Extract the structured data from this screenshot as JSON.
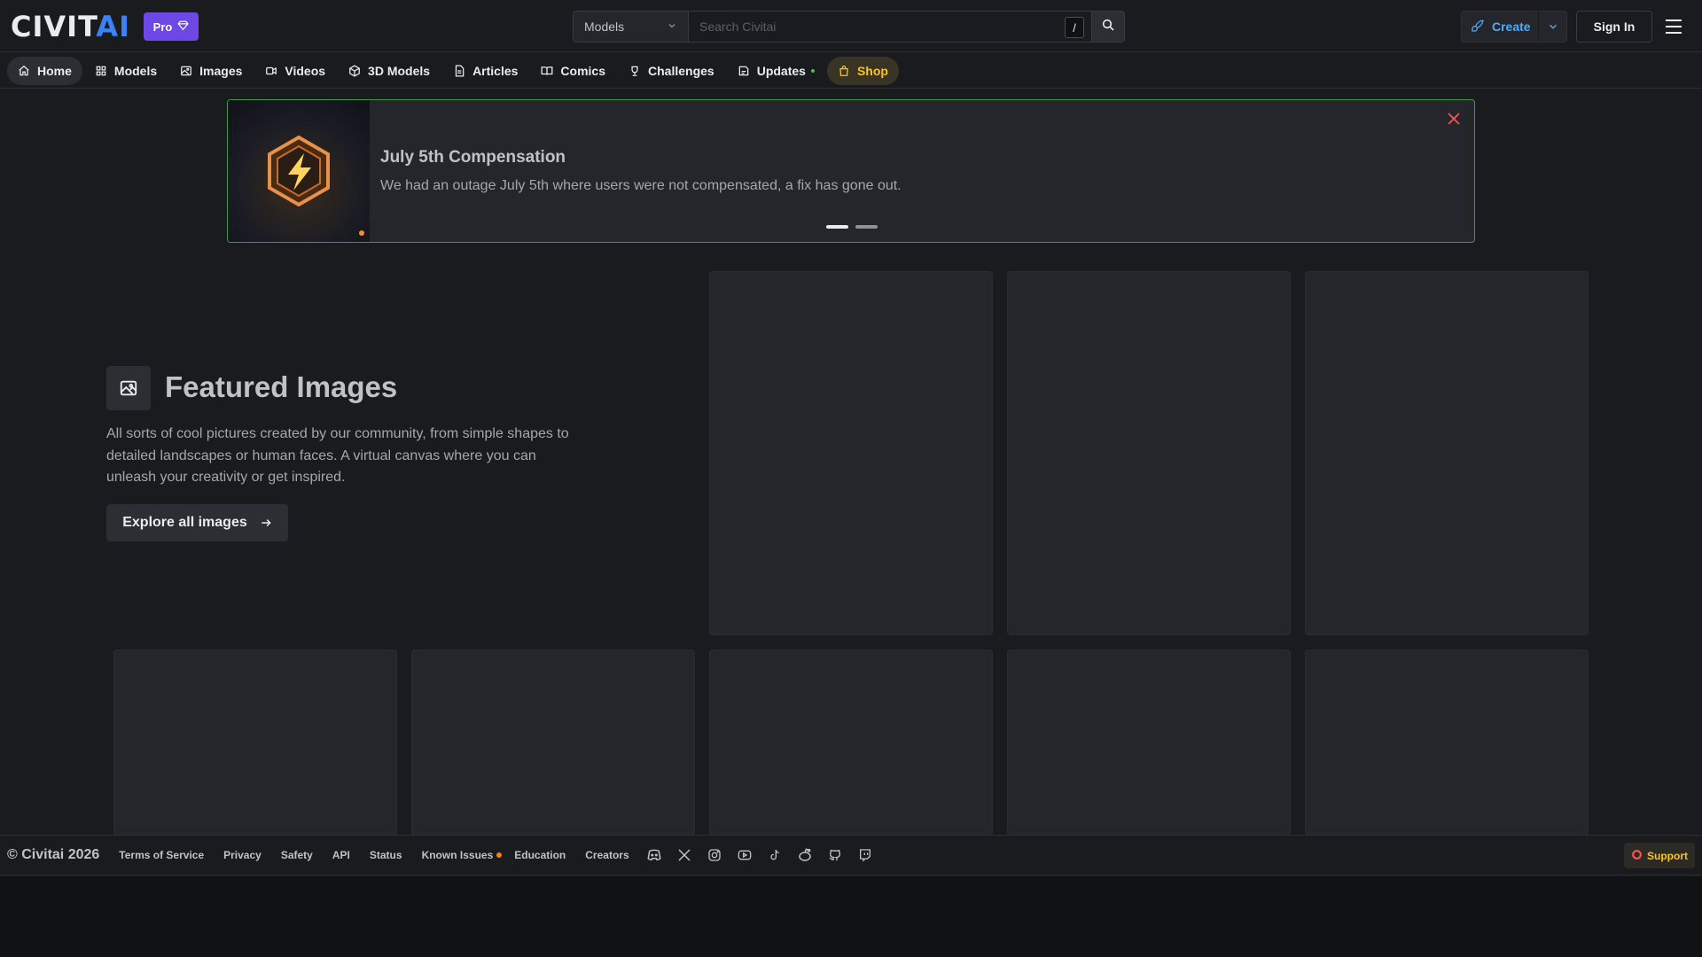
{
  "header": {
    "logo_part1": "CIVIT",
    "logo_part2": "AI",
    "pro_label": "Pro",
    "search": {
      "scope": "Models",
      "placeholder": "Search Civitai",
      "shortcut": "/"
    },
    "create_label": "Create",
    "signin_label": "Sign In"
  },
  "nav": {
    "items": [
      {
        "label": "Home",
        "icon": "home-icon"
      },
      {
        "label": "Models",
        "icon": "grid-icon"
      },
      {
        "label": "Images",
        "icon": "photo-icon"
      },
      {
        "label": "Videos",
        "icon": "video-icon"
      },
      {
        "label": "3D Models",
        "icon": "cube-icon"
      },
      {
        "label": "Articles",
        "icon": "file-text-icon"
      },
      {
        "label": "Comics",
        "icon": "book-icon"
      },
      {
        "label": "Challenges",
        "icon": "trophy-icon"
      },
      {
        "label": "Updates",
        "icon": "updates-icon"
      },
      {
        "label": "Shop",
        "icon": "shopping-bag-icon"
      }
    ],
    "active": "Home"
  },
  "banner": {
    "title": "July 5th Compensation",
    "text": "We had an outage July 5th where users were not compensated, a fix has gone out.",
    "slides": 2,
    "active_slide": 1
  },
  "featured": {
    "title": "Featured Images",
    "description": "All sorts of cool pictures created by our community, from simple shapes to detailed landscapes or human faces. A virtual canvas where you can unleash your creativity or get inspired.",
    "button_label": "Explore all images"
  },
  "footer": {
    "copyright": "© Civitai 2026",
    "links": [
      "Terms of Service",
      "Privacy",
      "Safety",
      "API",
      "Status",
      "Known Issues",
      "Education",
      "Creators"
    ],
    "socials": [
      "discord-icon",
      "x-icon",
      "instagram-icon",
      "youtube-icon",
      "tiktok-icon",
      "reddit-icon",
      "github-icon",
      "twitch-icon"
    ],
    "support_label": "Support"
  },
  "colors": {
    "accent_blue": "#4dabf7",
    "pro_purple": "#6d48e6",
    "shop_yellow": "#fcc419",
    "banner_border": "#2f9e44"
  }
}
